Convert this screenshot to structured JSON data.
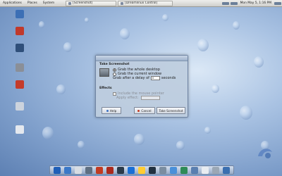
{
  "top_panel": {
    "menus": [
      "Applications",
      "Places",
      "System"
    ],
    "tasks": [
      "[Screenshot]",
      "[Dreamlinux Control]"
    ],
    "clock": "Mon May 5,  1:16 PM"
  },
  "desktop_icons": [
    {
      "label": "",
      "color": "#3c6fb5"
    },
    {
      "label": "",
      "color": "#c0392b"
    },
    {
      "label": "",
      "color": "#2f4f7a"
    },
    {
      "label": "",
      "color": "#8a8f98"
    },
    {
      "label": "",
      "color": "#c43b2a"
    },
    {
      "label": "",
      "color": "#ccd3dd"
    },
    {
      "label": "",
      "color": "#e4e8ee"
    }
  ],
  "dialog": {
    "section_title": "Take Screenshot",
    "option_whole": "Grab the whole desktop",
    "option_window": "Grab the current window",
    "delay_prefix": "Grab after a delay of",
    "delay_value": "0",
    "delay_suffix": "seconds",
    "effects_title": "Effects",
    "include_pointer": "Include the mouse pointer",
    "apply_effect": "Apply effect:",
    "help_label": "Help",
    "cancel_label": "Cancel",
    "take_label": "Take Screenshot"
  },
  "dock": {
    "icon_colors": [
      "#1f5fb8",
      "#3a78c8",
      "#d8dde3",
      "#5f6f82",
      "#c23b22",
      "#aa2a1e",
      "#2a3a4a",
      "#1a6fd6",
      "#ffcc33",
      "#203040",
      "#7a8da0",
      "#4a90d9",
      "#2e8b57",
      "#5a7fb0",
      "#e8ecf1",
      "#9aa7b5",
      "#3a6fb0"
    ]
  }
}
